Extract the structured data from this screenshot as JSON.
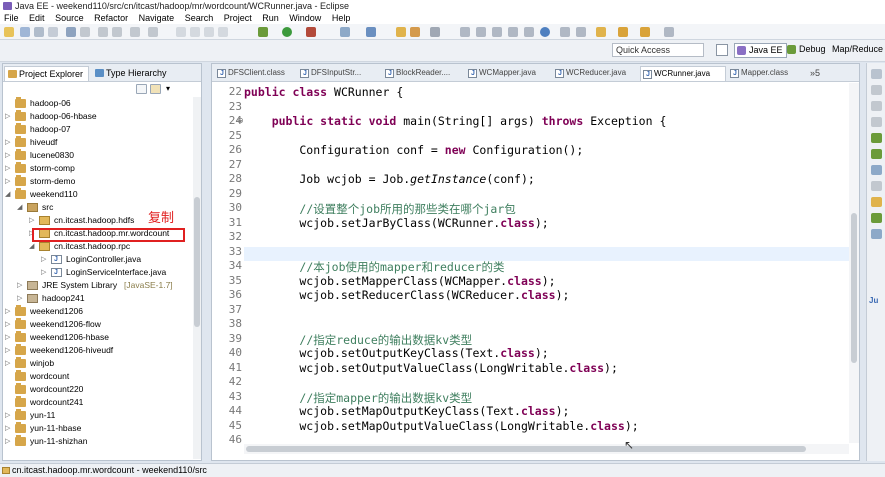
{
  "window": {
    "title": "Java EE - weekend110/src/cn/itcast/hadoop/mr/wordcount/WCRunner.java - Eclipse"
  },
  "menu": [
    "File",
    "Edit",
    "Source",
    "Refactor",
    "Navigate",
    "Search",
    "Project",
    "Run",
    "Window",
    "Help"
  ],
  "quick_access": {
    "placeholder": "Quick Access"
  },
  "perspectives": [
    "Java EE",
    "Debug",
    "Map/Reduce"
  ],
  "left_tabs": [
    "Project Explorer",
    "Type Hierarchy"
  ],
  "tree": [
    {
      "label": "hadoop-06",
      "type": "project",
      "depth": 0,
      "twisty": ""
    },
    {
      "label": "hadoop-06-hbase",
      "type": "project",
      "depth": 0,
      "twisty": "▷"
    },
    {
      "label": "hadoop-07",
      "type": "project",
      "depth": 0,
      "twisty": ""
    },
    {
      "label": "hiveudf",
      "type": "project",
      "depth": 0,
      "twisty": "▷"
    },
    {
      "label": "lucene0830",
      "type": "project",
      "depth": 0,
      "twisty": "▷"
    },
    {
      "label": "storm-comp",
      "type": "project",
      "depth": 0,
      "twisty": "▷"
    },
    {
      "label": "storm-demo",
      "type": "project",
      "depth": 0,
      "twisty": "▷"
    },
    {
      "label": "weekend110",
      "type": "project",
      "depth": 0,
      "twisty": "◢"
    },
    {
      "label": "src",
      "type": "src",
      "depth": 1,
      "twisty": "◢"
    },
    {
      "label": "cn.itcast.hadoop.hdfs",
      "type": "pkg",
      "depth": 2,
      "twisty": "▷"
    },
    {
      "label": "cn.itcast.hadoop.mr.wordcount",
      "type": "pkg",
      "depth": 2,
      "twisty": "▷"
    },
    {
      "label": "cn.itcast.hadoop.rpc",
      "type": "pkg",
      "depth": 2,
      "twisty": "◢"
    },
    {
      "label": "LoginController.java",
      "type": "jfile",
      "depth": 3,
      "twisty": "▷"
    },
    {
      "label": "LoginServiceInterface.java",
      "type": "jfile",
      "depth": 3,
      "twisty": "▷"
    },
    {
      "label": "JRE System Library",
      "suffix": "[JavaSE-1.7]",
      "type": "lib",
      "depth": 1,
      "twisty": "▷"
    },
    {
      "label": "hadoop241",
      "type": "lib",
      "depth": 1,
      "twisty": "▷"
    },
    {
      "label": "weekend1206",
      "type": "project",
      "depth": 0,
      "twisty": "▷"
    },
    {
      "label": "weekend1206-flow",
      "type": "project",
      "depth": 0,
      "twisty": "▷"
    },
    {
      "label": "weekend1206-hbase",
      "type": "project",
      "depth": 0,
      "twisty": "▷"
    },
    {
      "label": "weekend1206-hiveudf",
      "type": "project",
      "depth": 0,
      "twisty": "▷"
    },
    {
      "label": "winjob",
      "type": "project",
      "depth": 0,
      "twisty": "▷"
    },
    {
      "label": "wordcount",
      "type": "project",
      "depth": 0,
      "twisty": ""
    },
    {
      "label": "wordcount220",
      "type": "project",
      "depth": 0,
      "twisty": ""
    },
    {
      "label": "wordcount241",
      "type": "project",
      "depth": 0,
      "twisty": ""
    },
    {
      "label": "yun-11",
      "type": "project",
      "depth": 0,
      "twisty": "▷"
    },
    {
      "label": "yun-11-hbase",
      "type": "project",
      "depth": 0,
      "twisty": "▷"
    },
    {
      "label": "yun-11-shizhan",
      "type": "project",
      "depth": 0,
      "twisty": "▷"
    }
  ],
  "annotation": "复制",
  "editor_tabs": [
    "DFSClient.class",
    "DFSInputStr...",
    "BlockReader....",
    "WCMapper.java",
    "WCReducer.java",
    "WCRunner.java",
    "Mapper.class"
  ],
  "editor_tabs_overflow": "»5",
  "code_lines": [
    {
      "num": "22",
      "html": "<span class='kw'>public class</span> WCRunner {"
    },
    {
      "num": "23",
      "html": ""
    },
    {
      "num": "24",
      "html": "    <span class='kw'>public static void</span> main(String[] args) <span class='kw'>throws</span> Exception {"
    },
    {
      "num": "25",
      "html": ""
    },
    {
      "num": "26",
      "html": "        Configuration conf = <span class='kw'>new</span> Configuration();"
    },
    {
      "num": "27",
      "html": ""
    },
    {
      "num": "28",
      "html": "        Job wcjob = Job.<span class='it'>getInstance</span>(conf);"
    },
    {
      "num": "29",
      "html": ""
    },
    {
      "num": "30",
      "html": "        <span class='cm'>//设置整个job所用的那些类在哪个jar包</span>"
    },
    {
      "num": "31",
      "html": "        wcjob.setJarByClass(WCRunner.<span class='kw'>class</span>);"
    },
    {
      "num": "32",
      "html": ""
    },
    {
      "num": "33",
      "html": ""
    },
    {
      "num": "34",
      "html": "        <span class='cm'>//本job使用的mapper和reducer的类</span>"
    },
    {
      "num": "35",
      "html": "        wcjob.setMapperClass(WCMapper.<span class='kw'>class</span>);"
    },
    {
      "num": "36",
      "html": "        wcjob.setReducerClass(WCReducer.<span class='kw'>class</span>);"
    },
    {
      "num": "37",
      "html": ""
    },
    {
      "num": "38",
      "html": ""
    },
    {
      "num": "39",
      "html": "        <span class='cm'>//指定reduce的输出数据kv类型</span>"
    },
    {
      "num": "40",
      "html": "        wcjob.setOutputKeyClass(Text.<span class='kw'>class</span>);"
    },
    {
      "num": "41",
      "html": "        wcjob.setOutputValueClass(LongWritable.<span class='kw'>class</span>);"
    },
    {
      "num": "42",
      "html": ""
    },
    {
      "num": "43",
      "html": "        <span class='cm'>//指定mapper的输出数据kv类型</span>"
    },
    {
      "num": "44",
      "html": "        wcjob.setMapOutputKeyClass(Text.<span class='kw'>class</span>);"
    },
    {
      "num": "45",
      "html": "        wcjob.setMapOutputValueClass(LongWritable.<span class='kw'>class</span>);"
    },
    {
      "num": "46",
      "html": ""
    }
  ],
  "status": {
    "text": "cn.itcast.hadoop.mr.wordcount - weekend110/src"
  },
  "right_strip_label": "Ju"
}
